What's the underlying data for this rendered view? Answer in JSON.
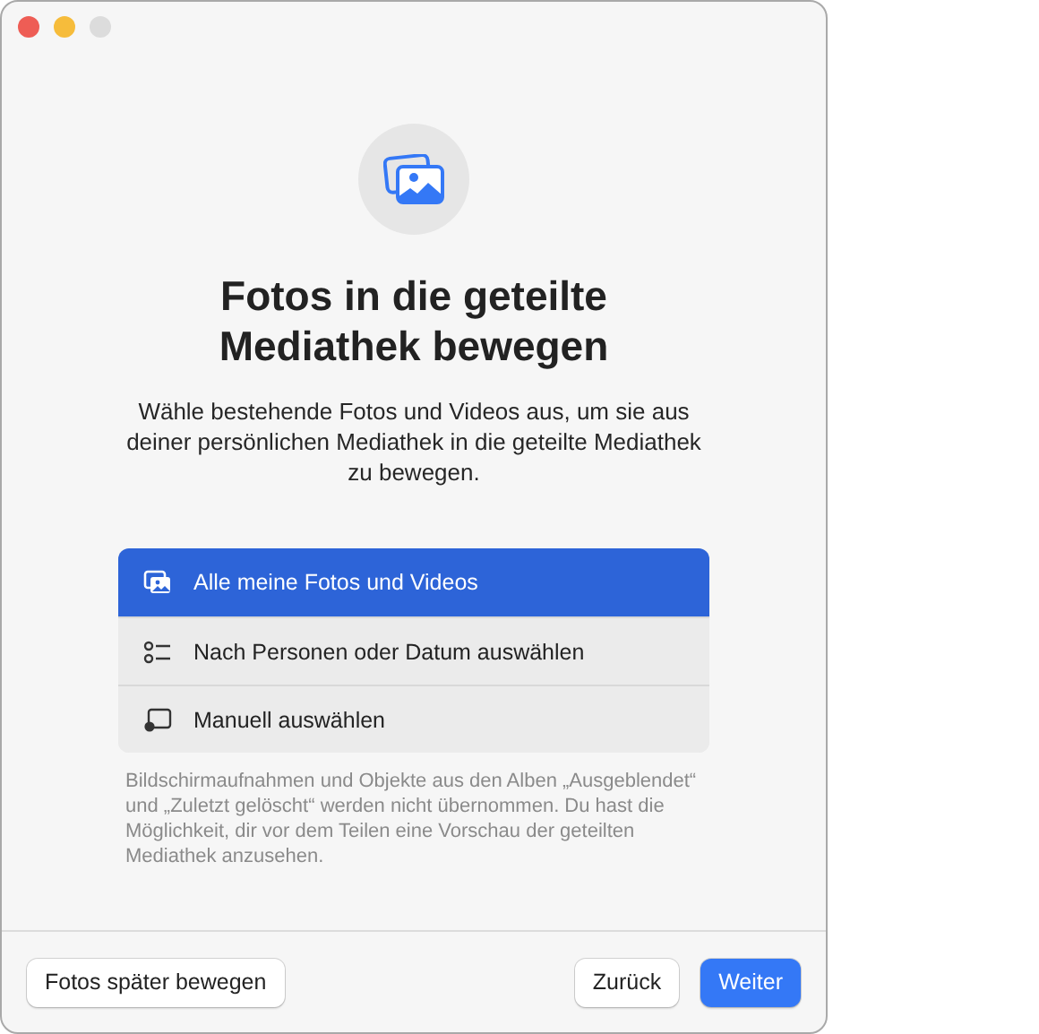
{
  "window": {
    "controls": [
      {
        "kind": "close"
      },
      {
        "kind": "minimize"
      },
      {
        "kind": "zoom",
        "disabled": true
      }
    ]
  },
  "title": "Fotos in die geteilte Mediathek bewegen",
  "description": "Wähle bestehende Fotos und Videos aus, um sie aus deiner persönlichen Mediathek in die geteilte Mediathek zu bewegen.",
  "options": [
    {
      "kind": "photos",
      "label": "Alle meine Fotos und Videos",
      "selected": true
    },
    {
      "kind": "filter",
      "label": "Nach Personen oder Datum auswählen",
      "selected": false
    },
    {
      "kind": "manual",
      "label": "Manuell auswählen",
      "selected": false
    }
  ],
  "note": "Bildschirmaufnahmen und Objekte aus den Alben „Ausgeblendet“ und „Zuletzt gelöscht“ werden nicht übernommen. Du hast die Möglichkeit, dir vor dem Teilen eine Vorschau der geteilten Mediathek anzusehen.",
  "buttons": [
    {
      "kind": "secondary",
      "label": "Fotos später bewegen"
    },
    {
      "kind": "spacer"
    },
    {
      "kind": "secondary",
      "label": "Zurück"
    },
    {
      "kind": "primary",
      "label": "Weiter"
    }
  ]
}
